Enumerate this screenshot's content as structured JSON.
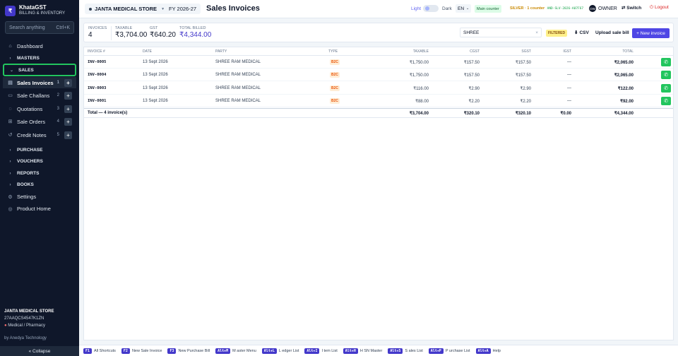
{
  "app": {
    "name": "KhataGST",
    "subtitle": "BILLING & INVENTORY",
    "logo": "₹"
  },
  "sidebar": {
    "search_placeholder": "Search anything",
    "search_shortcut": "Ctrl+K",
    "dashboard": "Dashboard",
    "masters": "MASTERS",
    "sales": "SALES",
    "sales_items": [
      {
        "label": "Sales Invoices",
        "count": "1"
      },
      {
        "label": "Sale Challans",
        "count": "2"
      },
      {
        "label": "Quotations",
        "count": "3"
      },
      {
        "label": "Sale Orders",
        "count": "4"
      },
      {
        "label": "Credit Notes",
        "count": "5"
      }
    ],
    "purchase": "PURCHASE",
    "vouchers": "VOUCHERS",
    "reports": "REPORTS",
    "books": "BOOKS",
    "settings": "Settings",
    "product_home": "Product Home",
    "store_name": "JANTA MEDICAL STORE",
    "store_gstin": "27AAQCS4547K1ZN",
    "store_type": "Medical / Pharmacy",
    "by_line": "by Anedya Technology",
    "collapse": "« Collapse"
  },
  "topbar": {
    "store": "JANTA MEDICAL STORE",
    "fy": "FY 2026-27",
    "title": "Sales Invoices",
    "light": "Light",
    "dark": "Dark",
    "lang": "EN",
    "counter": "Main counter",
    "plan": "SILVER · 1 counter",
    "plan_id": "AND-SLV-2026-A07F67",
    "role": "OWNER",
    "role_avatar": "OW",
    "switch": "Switch",
    "logout": "Logout"
  },
  "summary": {
    "invoices_label": "INVOICES",
    "invoices": "4",
    "taxable_label": "TAXABLE",
    "taxable": "₹3,704.00",
    "gst_label": "GST",
    "gst": "₹640.20",
    "billed_label": "TOTAL BILLED",
    "billed": "₹4,344.00",
    "search_value": "SHREE",
    "filtered": "FILTERED",
    "csv": "CSV",
    "upload": "Upload sale bill",
    "new_invoice": "+ New invoice"
  },
  "table": {
    "headers": [
      "INVOICE #",
      "DATE",
      "PARTY",
      "TYPE",
      "TAXABLE",
      "CGST",
      "SGST",
      "IGST",
      "TOTAL"
    ],
    "rows": [
      [
        "INV-0005",
        "13 Sept 2026",
        "SHREE RAM MEDICAL",
        "B2C",
        "₹1,750.00",
        "₹157.50",
        "₹157.50",
        "—",
        "₹2,065.00"
      ],
      [
        "INV-0004",
        "13 Sept 2026",
        "SHREE RAM MEDICAL",
        "B2C",
        "₹1,750.00",
        "₹157.50",
        "₹157.50",
        "—",
        "₹2,065.00"
      ],
      [
        "INV-0003",
        "13 Sept 2026",
        "SHREE RAM MEDICAL",
        "B2C",
        "₹116.00",
        "₹2.90",
        "₹2.90",
        "—",
        "₹122.00"
      ],
      [
        "INV-0001",
        "13 Sept 2026",
        "SHREE RAM MEDICAL",
        "B2C",
        "₹88.00",
        "₹2.20",
        "₹2.20",
        "—",
        "₹92.00"
      ]
    ],
    "total": {
      "label": "Total — 4 invoice(s)",
      "taxable": "₹3,704.00",
      "cgst": "₹320.10",
      "sgst": "₹320.10",
      "igst": "₹0.00",
      "total": "₹4,344.00"
    }
  },
  "shortcuts": [
    {
      "key": "F1",
      "label": "All Shortcuts"
    },
    {
      "key": "F2",
      "label": "New Sale Invoice"
    },
    {
      "key": "F3",
      "label": "New Purchase Bill"
    },
    {
      "key": "Alt+M",
      "label": "M aster Menu"
    },
    {
      "key": "Alt+L",
      "label": "L edger List"
    },
    {
      "key": "Alt+I",
      "label": "I tem List"
    },
    {
      "key": "Alt+H",
      "label": "H SN Master"
    },
    {
      "key": "Alt+S",
      "label": "S ales List"
    },
    {
      "key": "Alt+P",
      "label": "P urchase List"
    },
    {
      "key": "Alt+A",
      "label": "Help"
    }
  ],
  "colors": {
    "sidebar": "#0f172a",
    "accent": "#4f46e5",
    "highlight": "#22c55e"
  }
}
